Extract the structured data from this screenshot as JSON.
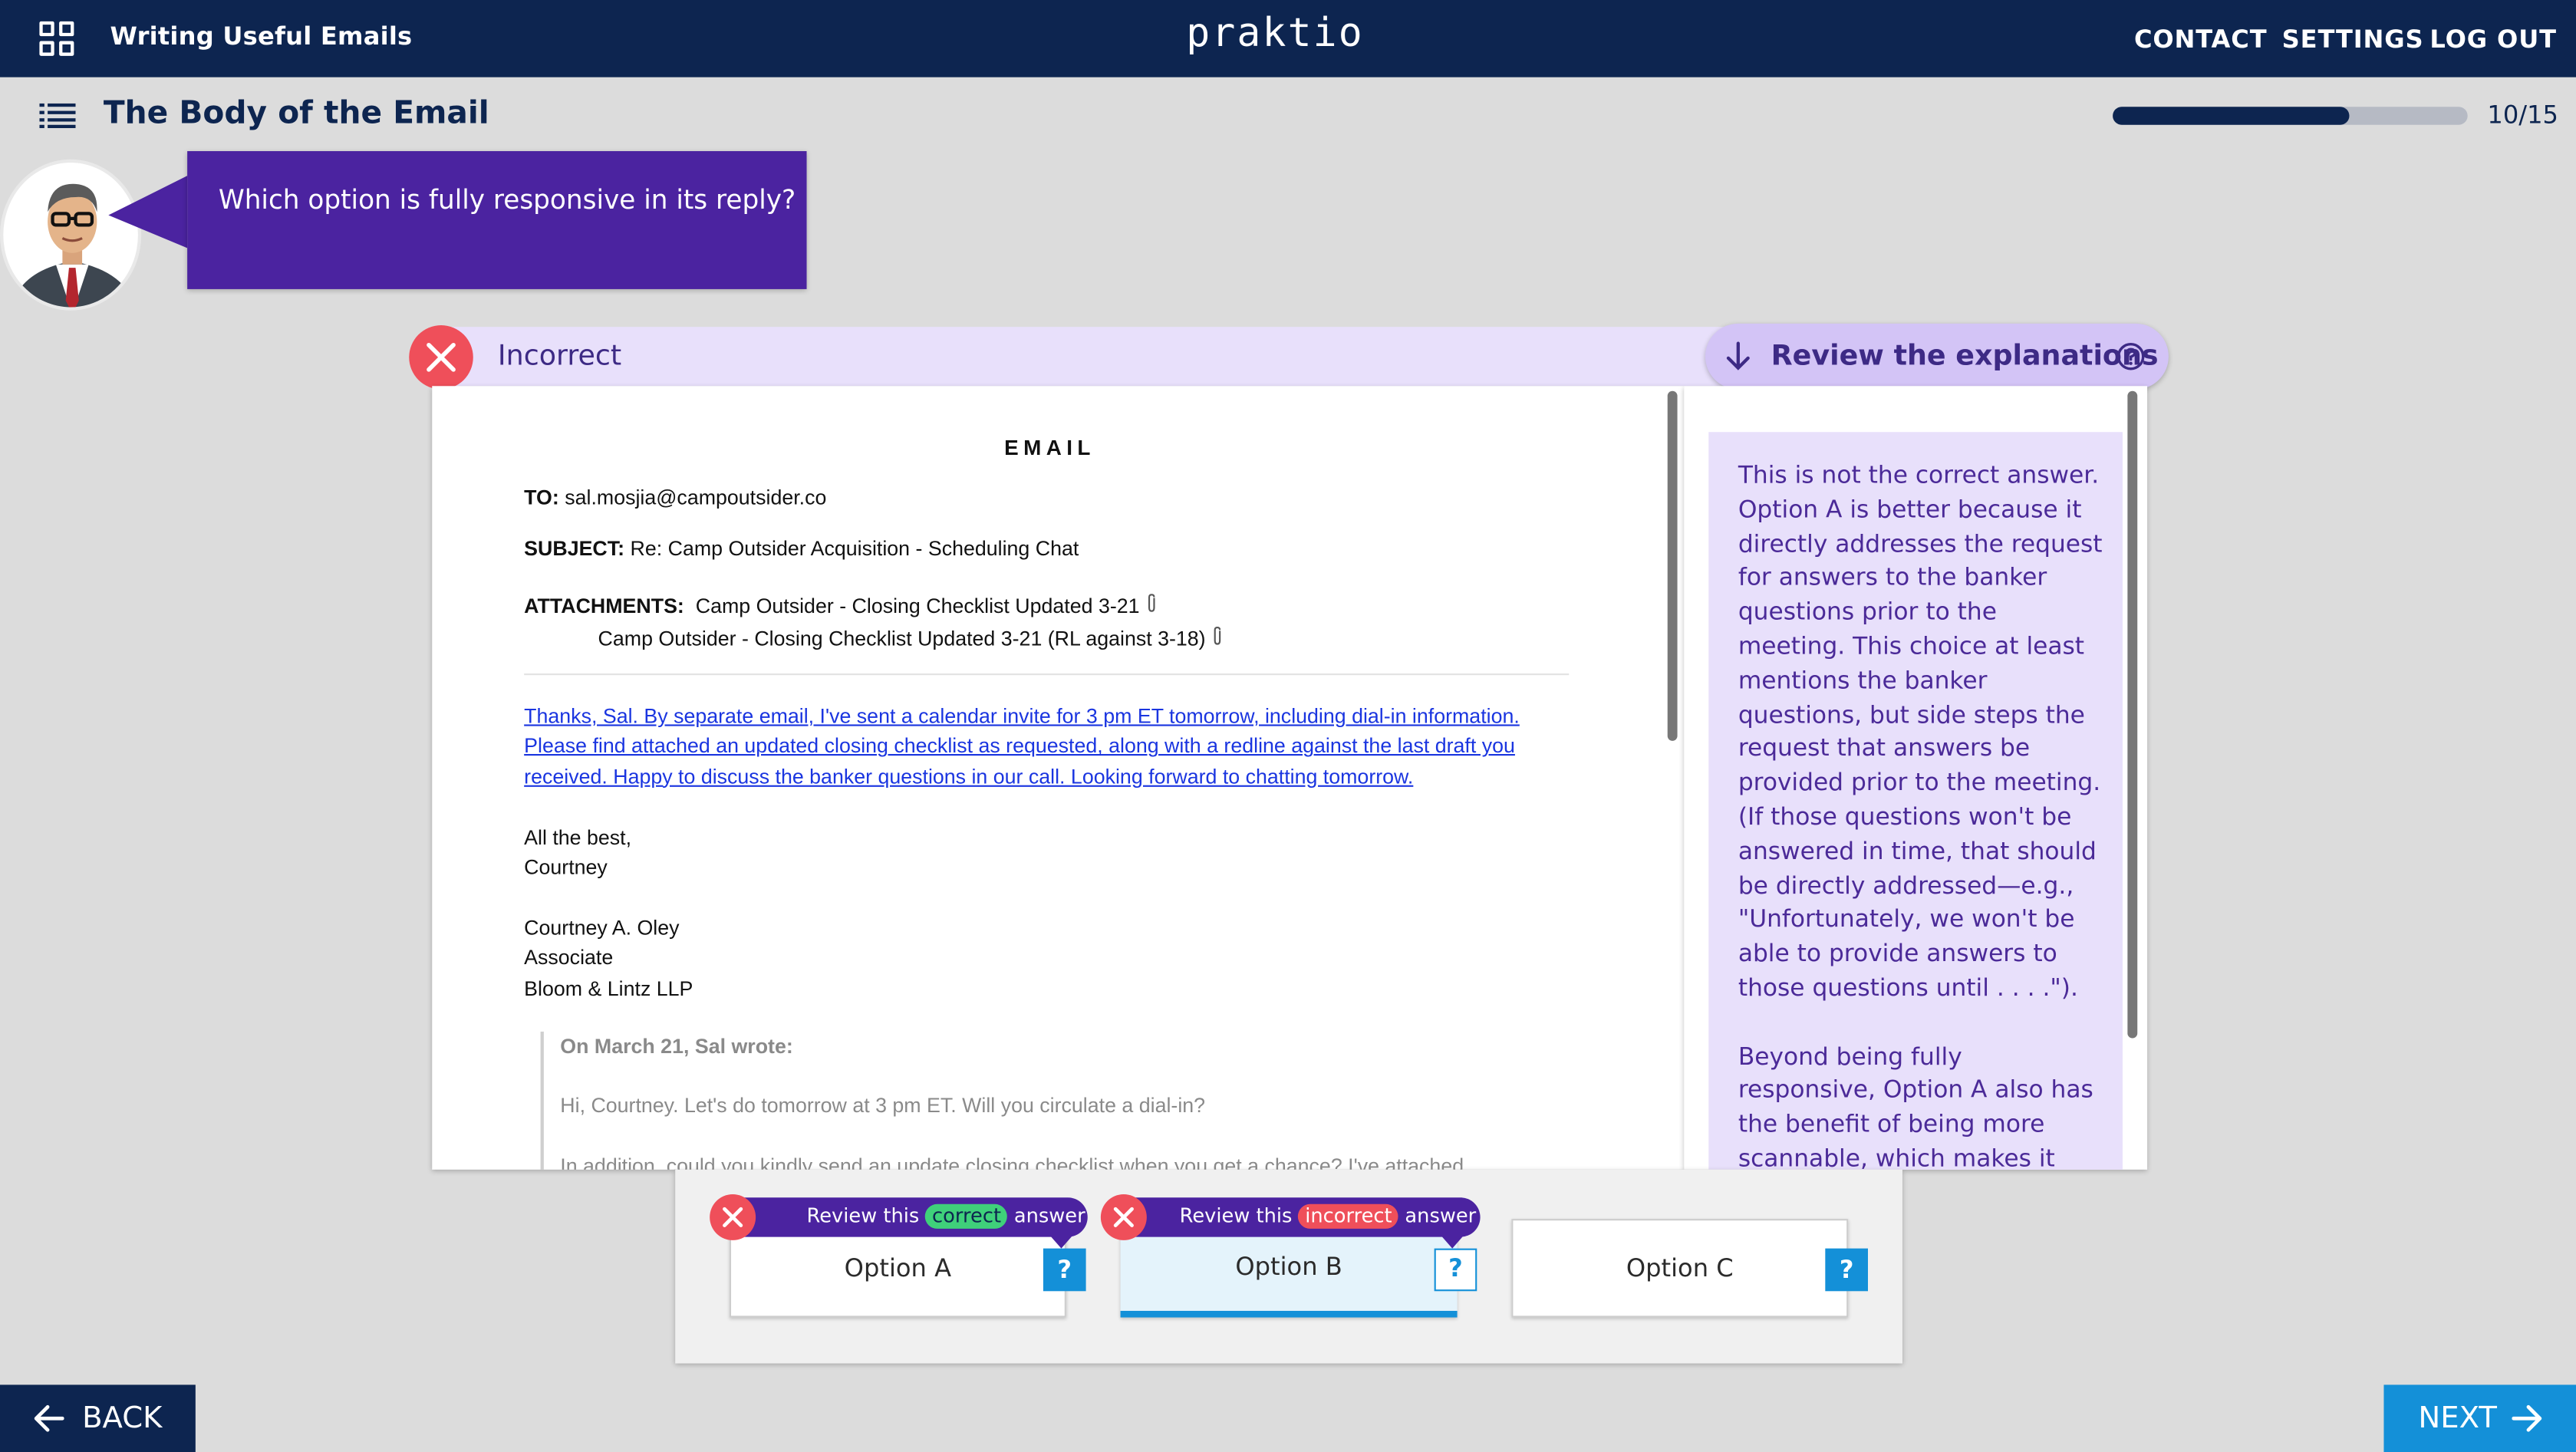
{
  "topbar": {
    "course_title": "Writing Useful Emails",
    "brand": "praktio",
    "links": [
      "CONTACT",
      "SETTINGS",
      "LOG OUT"
    ]
  },
  "lesson": {
    "title": "The Body of the Email",
    "progress_label": "10/15",
    "progress_fraction": 0.667
  },
  "question": "Which option is fully responsive in its reply?",
  "result": {
    "label": "Incorrect",
    "review_label": "Review the explanations"
  },
  "email": {
    "heading": "EMAIL",
    "to_label": "TO:",
    "to_value": "sal.mosjia@campoutsider.co",
    "subject_label": "SUBJECT:",
    "subject_value": "Re: Camp Outsider Acquisition - Scheduling Chat",
    "attachments_label": "ATTACHMENTS:",
    "attachment_1": "Camp Outsider - Closing Checklist Updated 3-21",
    "attachment_2": "Camp Outsider - Closing Checklist Updated 3-21 (RL against 3-18)",
    "body_line_1": "Thanks, Sal. By separate email, I've sent a calendar invite for 3 pm ET tomorrow, including dial-in information.",
    "body_line_2": "Please find attached an updated closing checklist as requested, along with a redline against the last draft you",
    "body_line_3": "received. Happy to discuss the banker questions in our call. Looking forward to chatting tomorrow.",
    "signoff_1": "All the best,",
    "signoff_2": "Courtney",
    "signature_name": "Courtney A. Oley",
    "signature_title": "Associate",
    "signature_firm": "Bloom & Lintz LLP",
    "quoted_header": "On March 21, Sal wrote:",
    "quoted_line_1": "Hi, Courtney. Let's do tomorrow at 3 pm ET. Will you circulate a dial-in?",
    "quoted_line_2": "In addition, could you kindly send an update closing checklist when you get a chance? I've attached"
  },
  "explanation": {
    "paragraph_1": "This is not the correct answer. Option A is better because it directly addresses the request for answers to the banker questions prior to the meeting. This choice at least mentions the banker questions, but side steps the request that answers be provided prior to the meeting. (If those questions won't be answered in time, that should be directly addressed—e.g., \"Unfortunately, we won't be able to provide answers to those questions until . . . .\").",
    "paragraph_2": "Beyond being fully responsive, Option A also has the benefit of being more scannable, which makes it easier to tick"
  },
  "options": [
    {
      "label": "Option A",
      "help": "?",
      "pill_prefix": "Review this",
      "pill_tag": "correct",
      "pill_suffix": "answer"
    },
    {
      "label": "Option B",
      "help": "?",
      "pill_prefix": "Review this",
      "pill_tag": "incorrect",
      "pill_suffix": "answer"
    },
    {
      "label": "Option C",
      "help": "?"
    }
  ],
  "nav": {
    "back": "BACK",
    "next": "NEXT"
  },
  "colors": {
    "navy": "#0d2550",
    "purple": "#4b23a0",
    "lavender": "#e8e0fb",
    "accent_blue": "#1490d8",
    "error_red": "#ef4f5a",
    "correct_green": "#3fd07a"
  }
}
